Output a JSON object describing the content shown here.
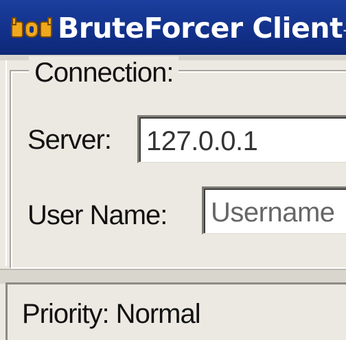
{
  "window": {
    "title": "BruteForcer Client",
    "title_edge": "-",
    "title_color": "#ffffff",
    "titlebar_color": "#12318b",
    "icon": "bruteforcer-app-icon"
  },
  "connection": {
    "legend": "Connection:",
    "server_label": "Server:",
    "server_value": "127.0.0.1",
    "username_label": "User Name:",
    "username_placeholder": "Username"
  },
  "status": {
    "priority_text": "Priority: Normal"
  }
}
